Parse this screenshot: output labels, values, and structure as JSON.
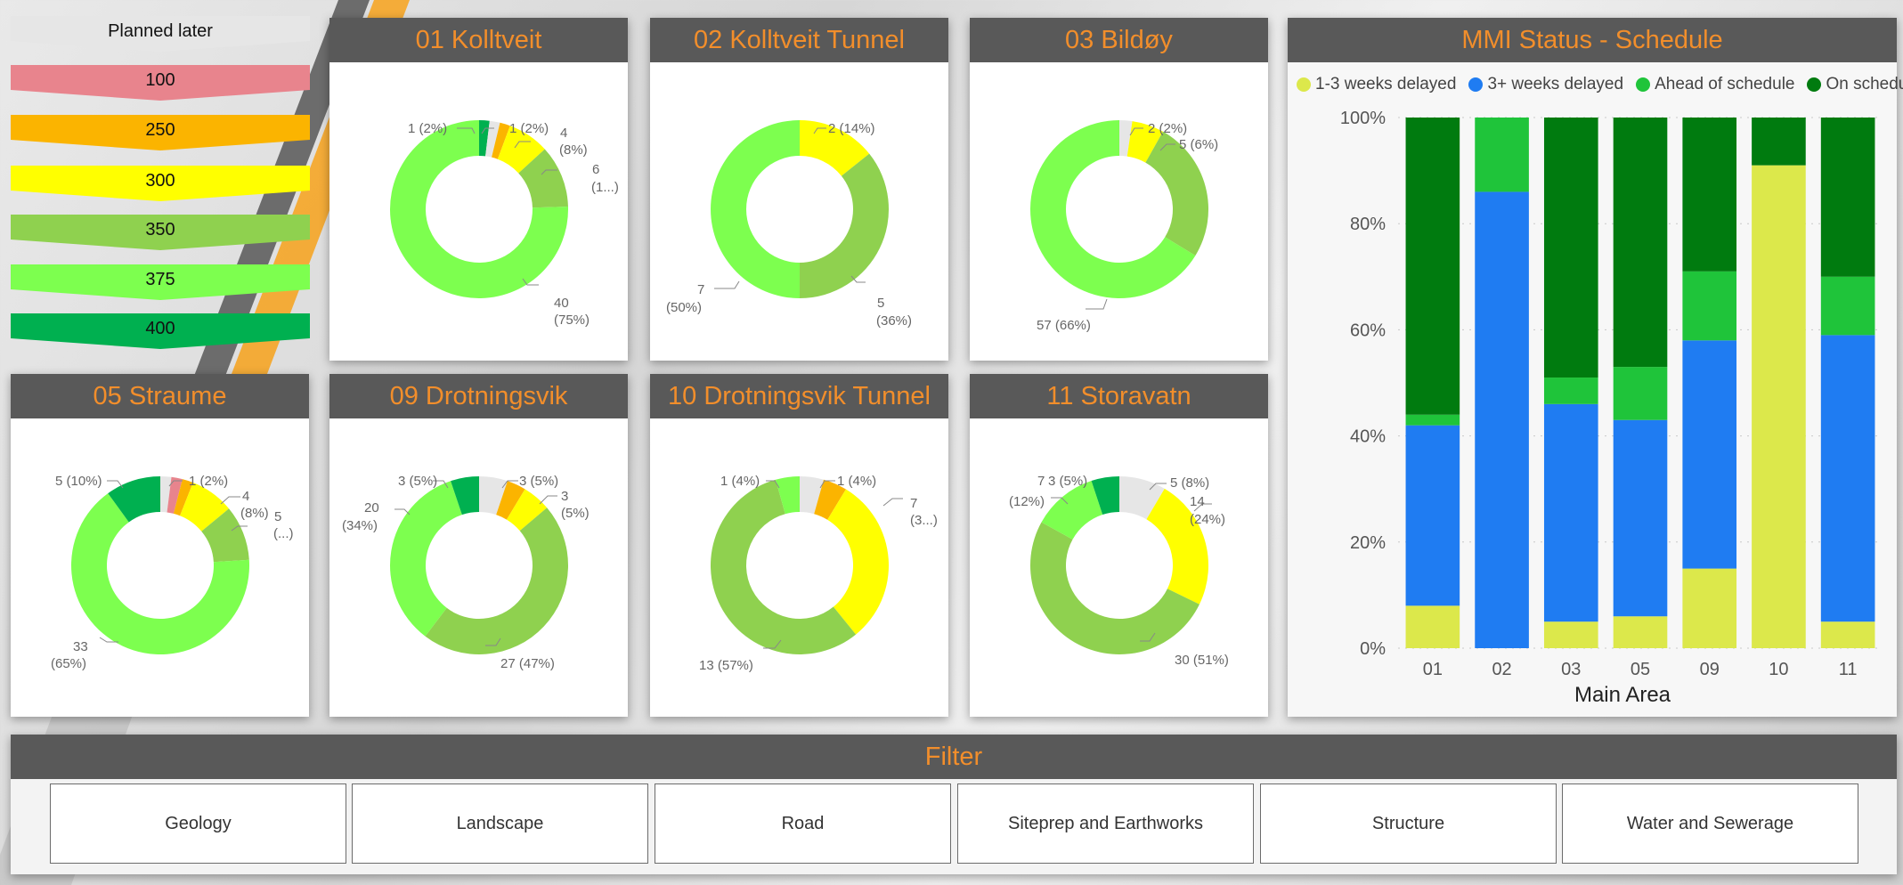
{
  "legend_steps": [
    {
      "label": "Planned later",
      "color": "#e6e6e6"
    },
    {
      "label": "100",
      "color": "#e8848d"
    },
    {
      "label": "250",
      "color": "#fbb400"
    },
    {
      "label": "300",
      "color": "#ffff00"
    },
    {
      "label": "350",
      "color": "#8fd14f"
    },
    {
      "label": "375",
      "color": "#7dff4f"
    },
    {
      "label": "400",
      "color": "#00b050"
    }
  ],
  "donuts": [
    {
      "title": "01 Kolltveit",
      "segments": [
        {
          "value": 1,
          "color": "#00b050"
        },
        {
          "value": 1,
          "color": "#e6e6e6"
        },
        {
          "value": 1,
          "color": "#fbb400"
        },
        {
          "value": 4,
          "color": "#ffff00"
        },
        {
          "value": 6,
          "color": "#8fd14f"
        },
        {
          "value": 40,
          "color": "#7dff4f"
        }
      ],
      "labels": [
        "1 (2%)",
        "1 (2%)",
        "4",
        "(8%)",
        "6",
        "(1...)",
        "40",
        "(75%)"
      ]
    },
    {
      "title": "02 Kolltveit Tunnel",
      "segments": [
        {
          "value": 2,
          "color": "#ffff00"
        },
        {
          "value": 5,
          "color": "#8fd14f"
        },
        {
          "value": 7,
          "color": "#7dff4f"
        }
      ],
      "labels": [
        "2 (14%)",
        "5",
        "(36%)",
        "7",
        "(50%)"
      ]
    },
    {
      "title": "03 Bildøy",
      "segments": [
        {
          "value": 2,
          "color": "#e6e6e6"
        },
        {
          "value": 5,
          "color": "#ffff00"
        },
        {
          "value": 22,
          "color": "#8fd14f"
        },
        {
          "value": 57,
          "color": "#7dff4f"
        }
      ],
      "labels": [
        "2 (2%)",
        "5 (6%)",
        "57 (66%)"
      ]
    },
    {
      "title": "05 Straume",
      "segments": [
        {
          "value": 1,
          "color": "#e6e6e6"
        },
        {
          "value": 1,
          "color": "#e8848d"
        },
        {
          "value": 1,
          "color": "#fbb400"
        },
        {
          "value": 4,
          "color": "#ffff00"
        },
        {
          "value": 5,
          "color": "#8fd14f"
        },
        {
          "value": 33,
          "color": "#7dff4f"
        },
        {
          "value": 5,
          "color": "#00b050"
        }
      ],
      "labels": [
        "1 (2%)",
        "4",
        "(8%)",
        "5",
        "(...)",
        "5 (10%)",
        "33",
        "(65%)"
      ]
    },
    {
      "title": "09 Drotningsvik",
      "segments": [
        {
          "value": 3,
          "color": "#e6e6e6"
        },
        {
          "value": 2,
          "color": "#fbb400"
        },
        {
          "value": 3,
          "color": "#ffff00"
        },
        {
          "value": 27,
          "color": "#8fd14f"
        },
        {
          "value": 20,
          "color": "#7dff4f"
        },
        {
          "value": 3,
          "color": "#00b050"
        }
      ],
      "labels": [
        "3 (5%)",
        "3 (5%)",
        "3",
        "(5%)",
        "20",
        "(34%)",
        "27 (47%)"
      ]
    },
    {
      "title": "10 Drotningsvik Tunnel",
      "segments": [
        {
          "value": 1,
          "color": "#e6e6e6"
        },
        {
          "value": 1,
          "color": "#fbb400"
        },
        {
          "value": 7,
          "color": "#ffff00"
        },
        {
          "value": 13,
          "color": "#8fd14f"
        },
        {
          "value": 1,
          "color": "#7dff4f"
        }
      ],
      "labels": [
        "1 (4%)",
        "1 (4%)",
        "7",
        "(3...)",
        "13 (57%)"
      ]
    },
    {
      "title": "11 Storavatn",
      "segments": [
        {
          "value": 5,
          "color": "#e6e6e6"
        },
        {
          "value": 14,
          "color": "#ffff00"
        },
        {
          "value": 30,
          "color": "#8fd14f"
        },
        {
          "value": 7,
          "color": "#7dff4f"
        },
        {
          "value": 3,
          "color": "#00b050"
        }
      ],
      "labels": [
        "5 (8%)",
        "14",
        "(24%)",
        "30 (51%)",
        "7",
        "(12%)",
        "3 (5%)"
      ]
    }
  ],
  "mmi": {
    "title": "MMI Status - Schedule",
    "chart_data": {
      "type": "bar",
      "stacked": "100%",
      "xlabel": "Main Area",
      "ylabel": "",
      "categories": [
        "01",
        "02",
        "03",
        "05",
        "09",
        "10",
        "11"
      ],
      "yticks": [
        "0%",
        "20%",
        "40%",
        "60%",
        "80%",
        "100%"
      ],
      "ylim": [
        0,
        100
      ],
      "legend_position": "top",
      "series": [
        {
          "name": "1-3 weeks delayed",
          "color": "#dce84b",
          "values": [
            8,
            0,
            5,
            6,
            15,
            91,
            5
          ]
        },
        {
          "name": "3+ weeks delayed",
          "color": "#1f7cf2",
          "values": [
            34,
            86,
            41,
            37,
            43,
            0,
            54
          ]
        },
        {
          "name": "Ahead of schedule",
          "color": "#1fc43a",
          "values": [
            2,
            14,
            5,
            10,
            13,
            0,
            11
          ]
        },
        {
          "name": "On schedule",
          "color": "#007b0f",
          "values": [
            56,
            0,
            49,
            47,
            29,
            9,
            30
          ]
        }
      ]
    }
  },
  "filter": {
    "title": "Filter",
    "buttons": [
      "Geology",
      "Landscape",
      "Road",
      "Siteprep and Earthworks",
      "Structure",
      "Water and Sewerage"
    ]
  }
}
